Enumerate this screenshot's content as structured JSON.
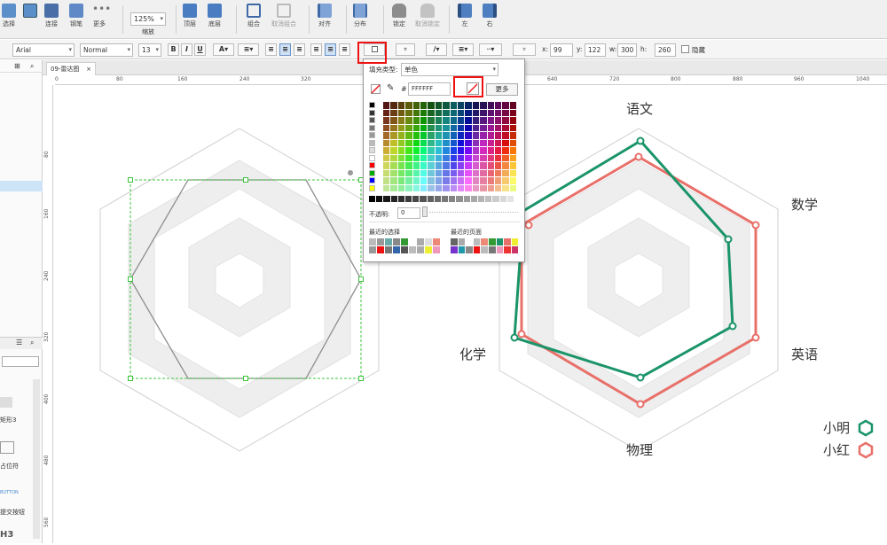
{
  "toolbar": {
    "select_label": "选择",
    "connect_label": "连接",
    "pen_label": "钢笔",
    "more_label": "更多",
    "zoom_value": "125%",
    "zoom_label": "缩放",
    "top_label": "顶层",
    "bottom_label": "底层",
    "group_label": "组合",
    "ungroup_label": "取消组合",
    "align_label": "对齐",
    "distribute_label": "分布",
    "lock_label": "锁定",
    "unlock_label": "取消锁定",
    "left_label": "左",
    "right_label": "右"
  },
  "style_bar": {
    "font": "Arial",
    "weight": "Normal",
    "size": "13",
    "bold": "B",
    "italic": "I",
    "underline": "U",
    "x_label": "x:",
    "x_value": "99",
    "y_label": "y:",
    "y_value": "122",
    "w_label": "w:",
    "w_value": "300",
    "h_label": "h:",
    "h_value": "260",
    "hidden_label": "隐藏"
  },
  "tab": {
    "title": "09-雷达图",
    "close": "×"
  },
  "ruler_top": [
    "0",
    "80",
    "160",
    "240",
    "320",
    "640",
    "720",
    "800",
    "880",
    "960",
    "1040"
  ],
  "ruler_left": [
    "80",
    "160",
    "240",
    "320",
    "400",
    "480",
    "560"
  ],
  "left_panel": {
    "items": [
      "矩形3",
      "占位符",
      "提交按钮",
      "H3"
    ],
    "button_small": "BUTTON"
  },
  "fill_popup": {
    "type_label": "填充类型:",
    "type_value": "单色",
    "hash": "#",
    "hex_value": "FFFFFF",
    "more_button": "更多",
    "opacity_label": "不透明:",
    "opacity_value": "0",
    "recent_selection_label": "最近的选择",
    "recent_page_label": "最近的页面"
  },
  "chart_data": {
    "type": "radar",
    "categories": [
      "语文",
      "数学",
      "英语",
      "物理",
      "化学"
    ],
    "series": [
      {
        "name": "小明",
        "color": "#1a9468"
      },
      {
        "name": "小红",
        "color": "#e8706a"
      }
    ],
    "legend_position": "bottom-right"
  },
  "colors": {
    "accent_red": "#e11111",
    "selection_green": "#3ec43e",
    "series1": "#1a9468",
    "series2": "#e8706a"
  }
}
